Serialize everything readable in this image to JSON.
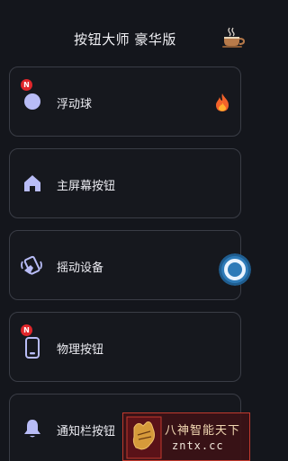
{
  "header": {
    "title": "按钮大师 豪华版",
    "coffee_icon": "coffee-cup-icon"
  },
  "cards": [
    {
      "label": "浮动球",
      "icon": "floating-ball-icon",
      "badge": "N",
      "hot_icon": "fire-icon"
    },
    {
      "label": "主屏幕按钮",
      "icon": "home-icon"
    },
    {
      "label": "摇动设备",
      "icon": "shake-device-icon"
    },
    {
      "label": "物理按钮",
      "icon": "phone-icon",
      "badge": "N"
    },
    {
      "label": "通知栏按钮",
      "icon": "bell-icon"
    }
  ],
  "watermark": {
    "text": "八神智能天下",
    "url": "zntx.cc"
  },
  "colors": {
    "accent": "#b8bcf6",
    "badge": "#e0262b",
    "border": "#3a3d46",
    "background": "#14161c"
  }
}
